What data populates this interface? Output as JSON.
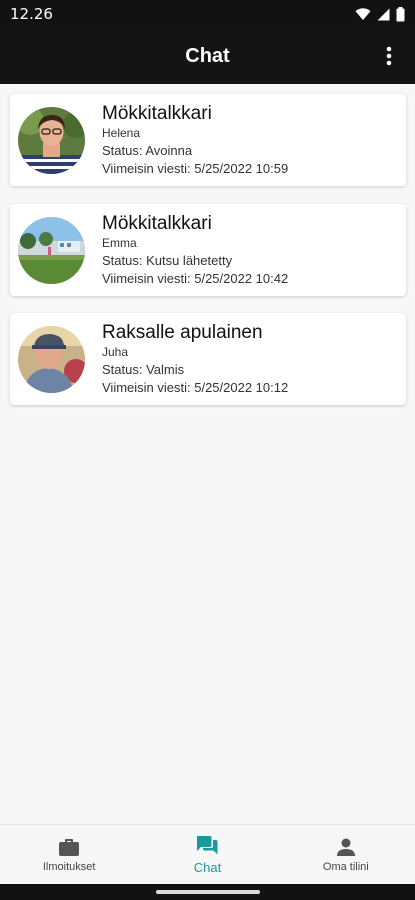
{
  "status_bar": {
    "time": "12.26",
    "icons": [
      "wifi-icon",
      "signal-icon",
      "battery-icon"
    ]
  },
  "app_bar": {
    "title": "Chat",
    "menu_icon": "more-vert-icon"
  },
  "chats": [
    {
      "title": "Mökkitalkkari",
      "name": "Helena",
      "status": "Status: Avoinna",
      "last_message": "Viimeisin viesti: 5/25/2022 10:59"
    },
    {
      "title": "Mökkitalkkari",
      "name": "Emma",
      "status": "Status: Kutsu lähetetty",
      "last_message": "Viimeisin viesti: 5/25/2022 10:42"
    },
    {
      "title": "Raksalle apulainen",
      "name": "Juha",
      "status": "Status: Valmis",
      "last_message": "Viimeisin viesti: 5/25/2022 10:12"
    }
  ],
  "bottom_nav": {
    "items": [
      {
        "label": "Ilmoitukset",
        "icon": "briefcase-icon",
        "active": false
      },
      {
        "label": "Chat",
        "icon": "chat-icon",
        "active": true
      },
      {
        "label": "Oma tilini",
        "icon": "person-icon",
        "active": false
      }
    ]
  },
  "colors": {
    "app_bar": "#141414",
    "accent": "#1a9b9b",
    "background": "#f7f7f7"
  }
}
